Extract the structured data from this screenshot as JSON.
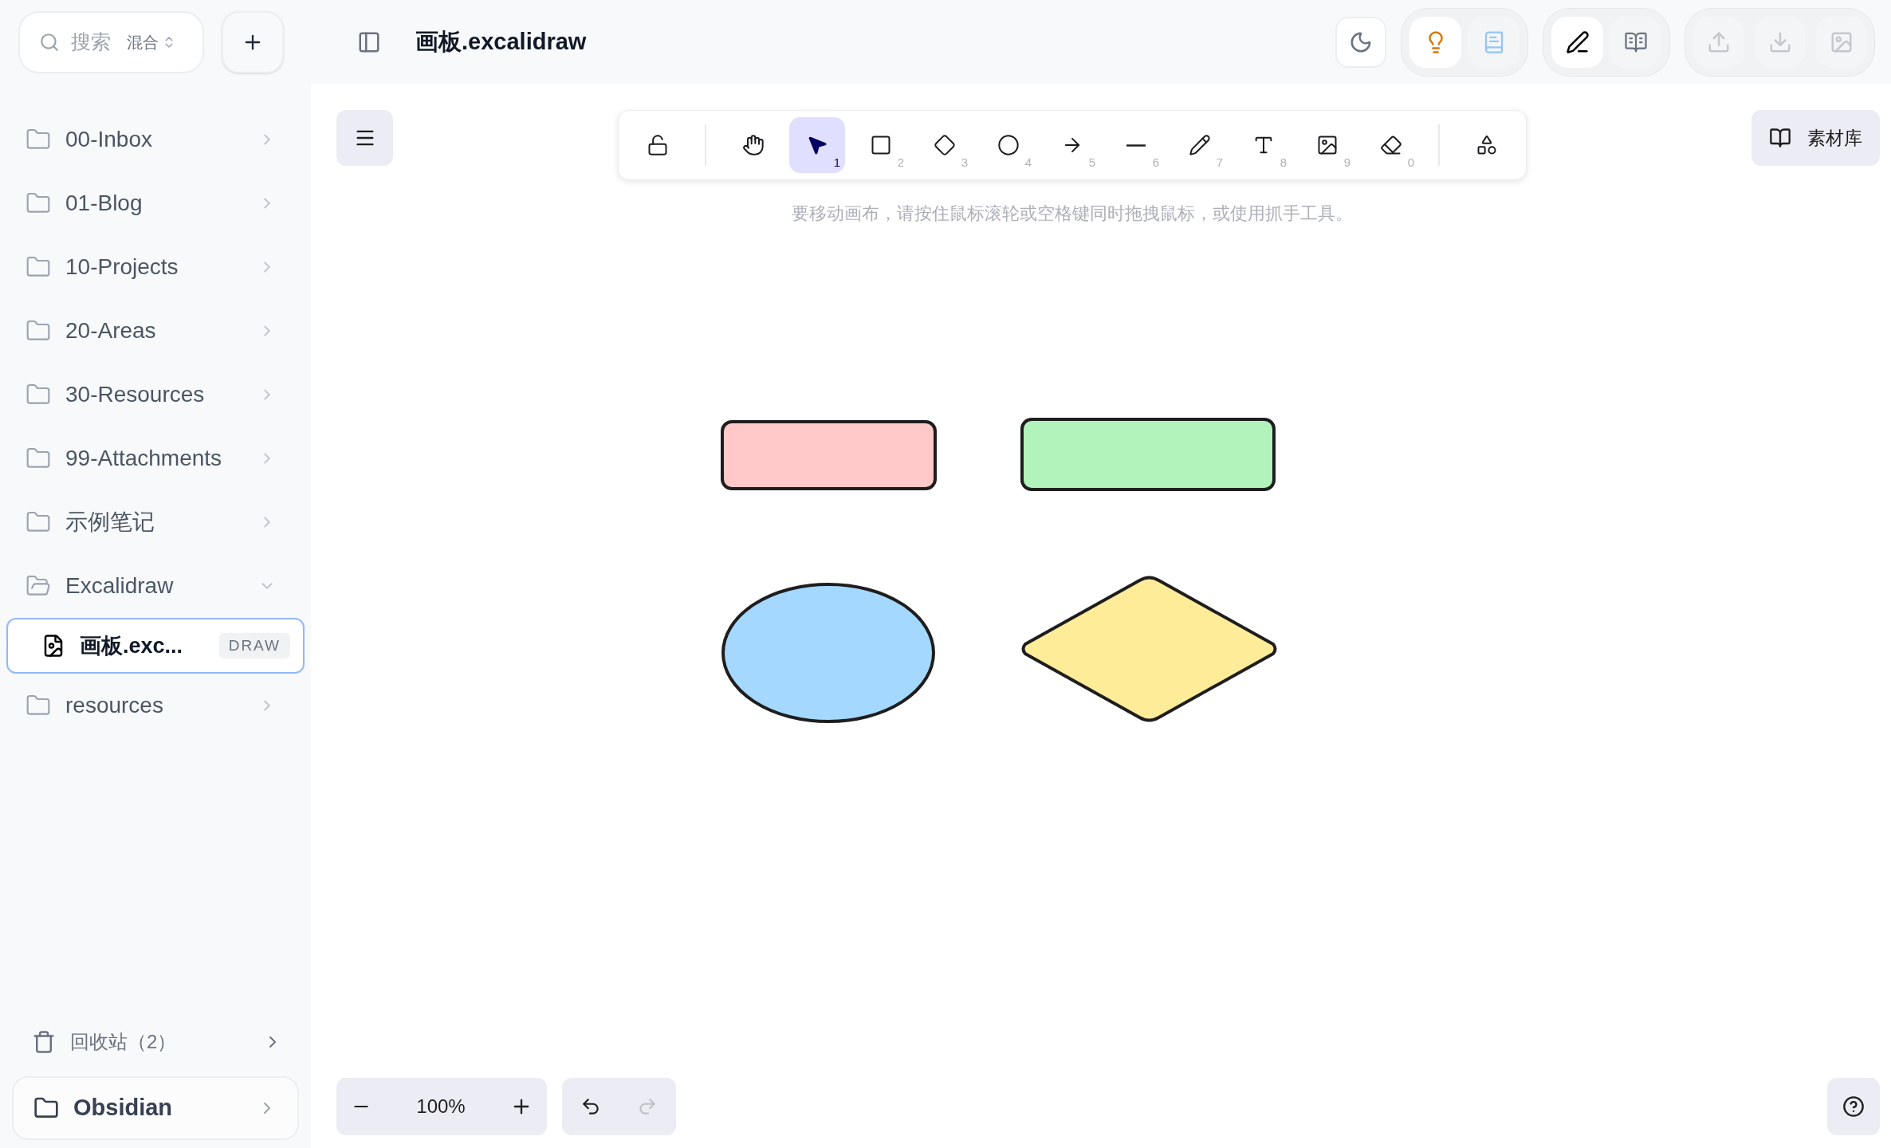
{
  "search": {
    "placeholder": "搜索",
    "mode": "混合"
  },
  "tab_title": "画板.excalidraw",
  "assist_modes": [
    {
      "kind": "bulb",
      "selected": true
    },
    {
      "kind": "book",
      "selected": false
    }
  ],
  "view_modes": [
    {
      "kind": "edit",
      "selected": true
    },
    {
      "kind": "read",
      "selected": false
    }
  ],
  "export_actions": [
    {
      "kind": "upload",
      "disabled": true
    },
    {
      "kind": "download",
      "disabled": true
    },
    {
      "kind": "image",
      "disabled": true
    }
  ],
  "sidebar": {
    "items": [
      {
        "label": "00-Inbox",
        "kind": "folder",
        "expanded": false
      },
      {
        "label": "01-Blog",
        "kind": "folder",
        "expanded": false
      },
      {
        "label": "10-Projects",
        "kind": "folder",
        "expanded": false
      },
      {
        "label": "20-Areas",
        "kind": "folder",
        "expanded": false
      },
      {
        "label": "30-Resources",
        "kind": "folder",
        "expanded": false
      },
      {
        "label": "99-Attachments",
        "kind": "folder",
        "expanded": false
      },
      {
        "label": "示例笔记",
        "kind": "folder",
        "expanded": false
      },
      {
        "label": "Excalidraw",
        "kind": "folder",
        "expanded": true,
        "children": [
          {
            "label": "画板.exc...",
            "kind": "file",
            "badge": "DRAW",
            "selected": true
          }
        ]
      },
      {
        "label": "resources",
        "kind": "folder",
        "expanded": false
      }
    ],
    "trash": "回收站（2）",
    "vault": "Obsidian"
  },
  "toolbar": {
    "tools": [
      {
        "kind": "lock",
        "selected": false
      },
      {
        "kind": "hand",
        "selected": false
      },
      {
        "kind": "select",
        "key": "1",
        "selected": true
      },
      {
        "kind": "rectangle",
        "key": "2",
        "selected": false
      },
      {
        "kind": "diamond",
        "key": "3",
        "selected": false
      },
      {
        "kind": "ellipse",
        "key": "4",
        "selected": false
      },
      {
        "kind": "arrow",
        "key": "5",
        "selected": false
      },
      {
        "kind": "line",
        "key": "6",
        "selected": false
      },
      {
        "kind": "pencil",
        "key": "7",
        "selected": false
      },
      {
        "kind": "text",
        "key": "8",
        "selected": false
      },
      {
        "kind": "image",
        "key": "9",
        "selected": false
      },
      {
        "kind": "eraser",
        "key": "0",
        "selected": false
      },
      {
        "kind": "shapes",
        "selected": false
      }
    ]
  },
  "hint": "要移动画布，请按住鼠标滚轮或空格键同时拖拽鼠标，或使用抓手工具。",
  "library_button": "素材库",
  "canvas": {
    "shapes": [
      {
        "kind": "rectangle",
        "color": "#ffc9c9"
      },
      {
        "kind": "rectangle",
        "color": "#b2f2bb"
      },
      {
        "kind": "ellipse",
        "color": "#a5d8ff"
      },
      {
        "kind": "diamond",
        "color": "#ffec99"
      }
    ]
  },
  "zoom": "100%",
  "history": [
    {
      "kind": "undo",
      "disabled": false
    },
    {
      "kind": "redo",
      "disabled": true
    }
  ]
}
